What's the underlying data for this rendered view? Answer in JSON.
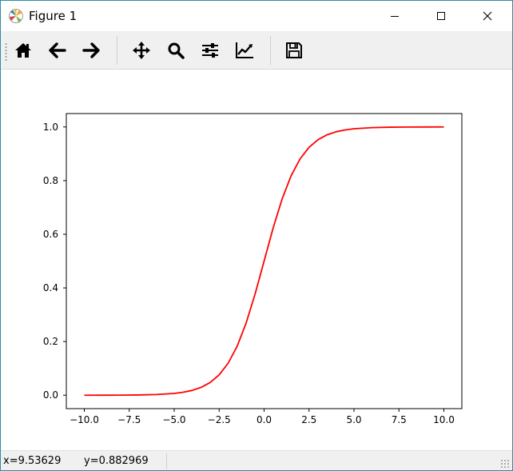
{
  "window": {
    "title": "Figure 1",
    "app_icon": "matplotlib-logo-icon",
    "controls": {
      "minimize": "minimize-icon",
      "maximize": "maximize-icon",
      "close": "close-icon"
    }
  },
  "toolbar": {
    "tools": [
      {
        "name": "home",
        "icon": "home-icon"
      },
      {
        "name": "back",
        "icon": "arrow-left-icon"
      },
      {
        "name": "forward",
        "icon": "arrow-right-icon"
      },
      {
        "name": "pan",
        "icon": "move-icon"
      },
      {
        "name": "zoom",
        "icon": "magnifier-icon"
      },
      {
        "name": "configure-subplots",
        "icon": "sliders-icon"
      },
      {
        "name": "edit-axis",
        "icon": "line-chart-icon"
      },
      {
        "name": "save",
        "icon": "floppy-disk-icon"
      }
    ]
  },
  "status": {
    "x_readout": "x=9.53629",
    "y_readout": "y=0.882969"
  },
  "chart_data": {
    "type": "line",
    "title": "",
    "xlabel": "",
    "ylabel": "",
    "xlim": [
      -11.0,
      11.0
    ],
    "ylim": [
      -0.05,
      1.05
    ],
    "grid": false,
    "x_ticks": [
      -10.0,
      -7.5,
      -5.0,
      -2.5,
      0.0,
      2.5,
      5.0,
      7.5,
      10.0
    ],
    "x_tick_labels": [
      "−10.0",
      "−7.5",
      "−5.0",
      "−2.5",
      "0.0",
      "2.5",
      "5.0",
      "7.5",
      "10.0"
    ],
    "y_ticks": [
      0.0,
      0.2,
      0.4,
      0.6,
      0.8,
      1.0
    ],
    "y_tick_labels": [
      "0.0",
      "0.2",
      "0.4",
      "0.6",
      "0.8",
      "1.0"
    ],
    "series": [
      {
        "color": "#ff0000",
        "x": [
          -10,
          -9,
          -8,
          -7,
          -6,
          -5,
          -4.5,
          -4,
          -3.5,
          -3,
          -2.5,
          -2,
          -1.5,
          -1,
          -0.5,
          0,
          0.5,
          1,
          1.5,
          2,
          2.5,
          3,
          3.5,
          4,
          4.5,
          5,
          6,
          7,
          8,
          9,
          10
        ],
        "y": [
          0.0,
          0.0001,
          0.0003,
          0.0009,
          0.0025,
          0.0067,
          0.011,
          0.018,
          0.0293,
          0.0474,
          0.0759,
          0.1192,
          0.1824,
          0.2689,
          0.3775,
          0.5,
          0.6225,
          0.7311,
          0.8176,
          0.8808,
          0.9241,
          0.9526,
          0.9707,
          0.982,
          0.989,
          0.9933,
          0.9975,
          0.9991,
          0.9997,
          0.9999,
          1.0
        ]
      }
    ]
  }
}
